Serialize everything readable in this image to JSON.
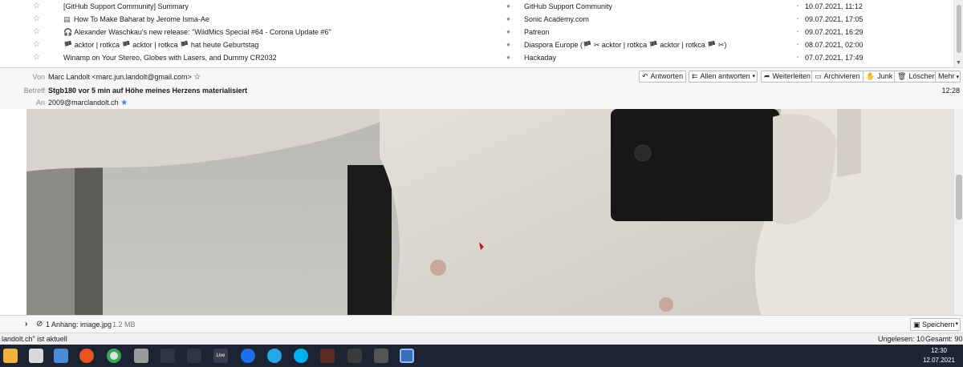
{
  "message_list": {
    "rows": [
      {
        "subject": "[GitHub Support Community] Summary",
        "icon": "",
        "sender": "GitHub Support Community",
        "date": "10.07.2021, 11:12"
      },
      {
        "subject": "How To Make Baharat by Jerome Isma-Ae",
        "icon": "feed-icon",
        "sender": "Sonic Academy.com",
        "date": "09.07.2021, 17:05"
      },
      {
        "subject": "🎧 Alexander Waschkau's new release: \"WildMics Special #64 - Corona Update #6\"",
        "icon": "",
        "sender": "Patreon",
        "date": "09.07.2021, 16:29"
      },
      {
        "subject": "🏴 acktor | rotkca 🏴 acktor | rotkca 🏴 hat heute Geburtstag",
        "icon": "",
        "sender": "Diaspora Europe (🏴 ✂ acktor | rotkca 🏴 acktor | rotkca 🏴 ✂)",
        "date": "08.07.2021, 02:00"
      },
      {
        "subject": "Winamp on Your Stereo, Globes with Lasers, and Dummy CR2032",
        "icon": "",
        "sender": "Hackaday",
        "date": "07.07.2021, 17:49"
      }
    ]
  },
  "header": {
    "from_label": "Von",
    "from_value": "Marc Landolt <marc.jun.landolt@gmail.com>",
    "subject_label": "Betreff",
    "subject_value": "Stgb180 vor 5 min auf Höhe meines Herzens materialisiert",
    "to_label": "An",
    "to_value": "2009@marclandolt.ch",
    "time": "12:28",
    "buttons": {
      "reply": "Antworten",
      "reply_all": "Allen antworten",
      "forward": "Weiterleiten",
      "archive": "Archivieren",
      "junk": "Junk",
      "delete": "Löschen",
      "more": "Mehr"
    }
  },
  "attachment": {
    "label": "1 Anhang: image.jpg",
    "size": "1.2 MB",
    "save": "Speichern"
  },
  "status_bar": {
    "message": "landolt.ch\" ist aktuell",
    "unread": "Ungelesen: 10",
    "total": "Gesamt: 90"
  },
  "taskbar": {
    "time": "12:30",
    "date": "12.07.2021",
    "live_label": "Live"
  },
  "colors": {
    "header_bg": "#f7f7f7",
    "taskbar_bg": "#1c2433",
    "contact_star": "#3b82f6"
  }
}
